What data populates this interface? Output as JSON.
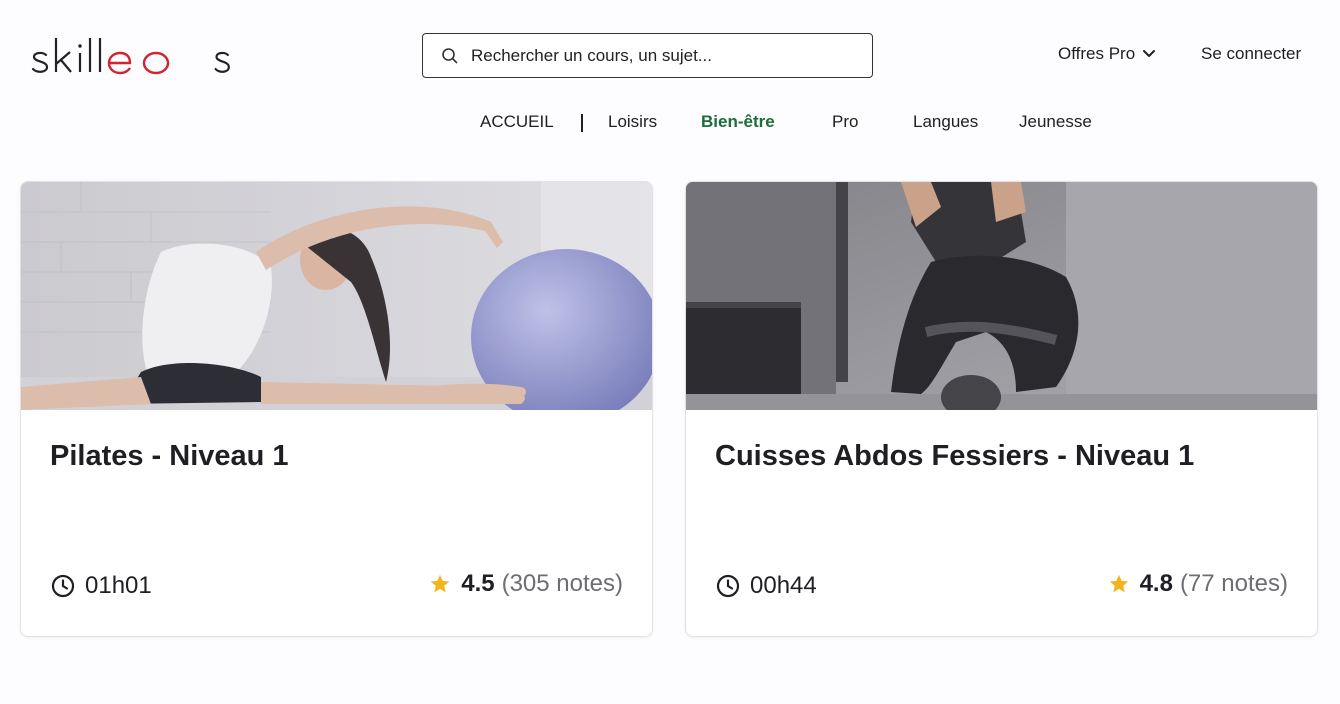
{
  "header": {
    "logo_text": "skilleos",
    "search": {
      "placeholder": "Rechercher un cours, un sujet..."
    },
    "offres_label": "Offres Pro",
    "connect_label": "Se connecter"
  },
  "nav": {
    "items": [
      {
        "label": "ACCUEIL"
      },
      {
        "label": "Loisirs"
      },
      {
        "label": "Bien-être",
        "active": true
      },
      {
        "label": "Pro"
      },
      {
        "label": "Langues"
      },
      {
        "label": "Jeunesse"
      }
    ]
  },
  "courses": [
    {
      "title": "Pilates - Niveau 1",
      "duration": "01h01",
      "rating": "4.5",
      "notes": "(305 notes)",
      "image_icon": "pilates-photo"
    },
    {
      "title": "Cuisses Abdos Fessiers - Niveau 1",
      "duration": "00h44",
      "rating": "4.8",
      "notes": "(77 notes)",
      "image_icon": "fitness-photo"
    }
  ],
  "colors": {
    "accent_active": "#1f6b3a",
    "logo_red": "#d0242f",
    "star": "#f2b51c"
  }
}
